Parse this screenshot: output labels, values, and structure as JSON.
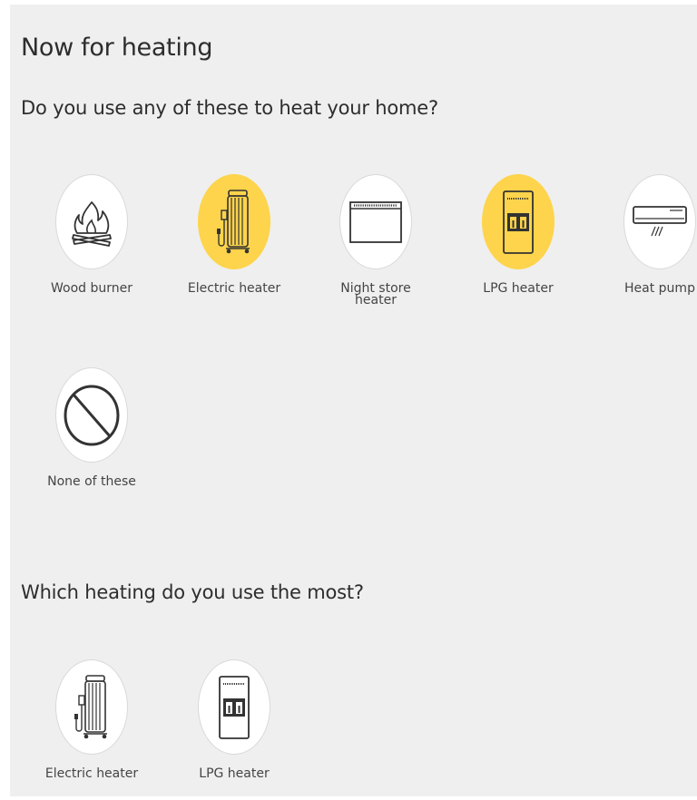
{
  "title": "Now for heating",
  "question1": {
    "text": "Do you use any of these to heat your home?",
    "options": [
      {
        "label": "Wood burner",
        "icon": "wood-burner-icon",
        "selected": false
      },
      {
        "label": "Electric heater",
        "icon": "electric-heater-icon",
        "selected": true
      },
      {
        "label": "Night store heater",
        "icon": "night-store-heater-icon",
        "selected": false
      },
      {
        "label": "LPG heater",
        "icon": "lpg-heater-icon",
        "selected": true
      },
      {
        "label": "Heat pump",
        "icon": "heat-pump-icon",
        "selected": false
      },
      {
        "label": "None of these",
        "icon": "none-icon",
        "selected": false
      }
    ]
  },
  "question2": {
    "text": "Which heating do you use the most?",
    "options": [
      {
        "label": "Electric heater",
        "icon": "electric-heater-icon",
        "selected": false
      },
      {
        "label": "LPG heater",
        "icon": "lpg-heater-icon",
        "selected": false
      }
    ]
  },
  "colors": {
    "background": "#efefef",
    "selected": "#fdd44b",
    "text": "#2d2d2d"
  }
}
